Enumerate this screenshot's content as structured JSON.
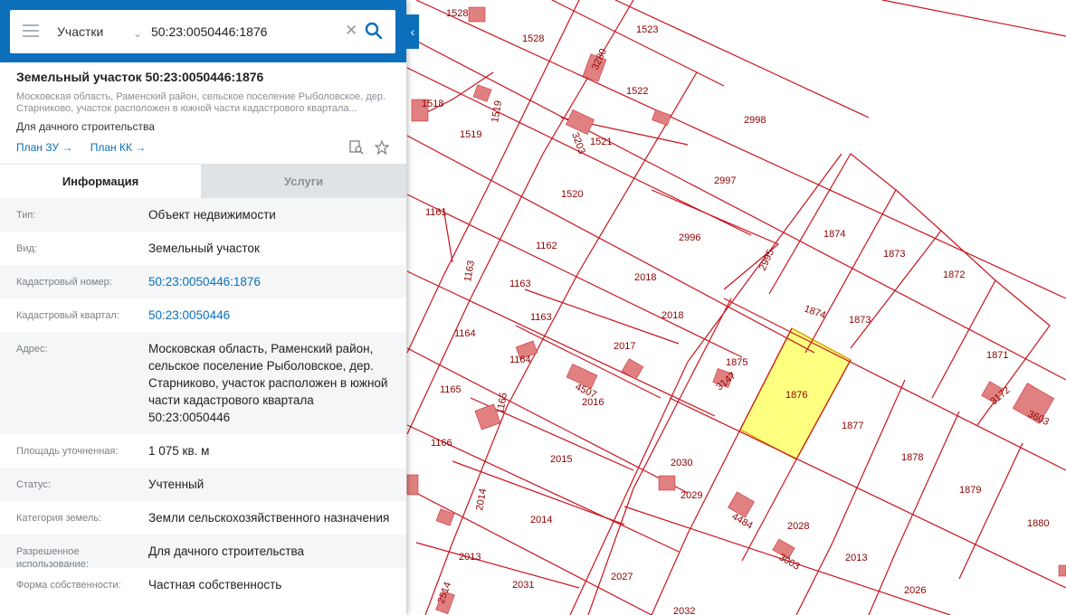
{
  "search": {
    "layer": "Участки",
    "query": "50:23:0050446:1876"
  },
  "parcel": {
    "title": "Земельный участок 50:23:0050446:1876",
    "address_short": "Московская область, Раменский район, сельское поселение Рыболовское, дер. Старниково, участок расположен в южной части кадастрового квартала...",
    "use": "Для дачного строительства",
    "links": [
      "План ЗУ →",
      "План КК →"
    ]
  },
  "tabs": [
    "Информация",
    "Услуги"
  ],
  "info": [
    {
      "key": "Тип:",
      "value": "Объект недвижимости",
      "link": false
    },
    {
      "key": "Вид:",
      "value": "Земельный участок",
      "link": false
    },
    {
      "key": "Кадастровый номер:",
      "value": "50:23:0050446:1876",
      "link": true
    },
    {
      "key": "Кадастровый квартал:",
      "value": "50:23:0050446",
      "link": true
    },
    {
      "key": "Адрес:",
      "value": "Московская область, Раменский район, сельское поселение Рыболовское, дер. Старниково, участок расположен в южной части кадастрового квартала 50:23:0050446",
      "link": false
    },
    {
      "key": "Площадь уточненная:",
      "value": "1 075 кв. м",
      "link": false
    },
    {
      "key": "Статус:",
      "value": "Учтенный",
      "link": false
    },
    {
      "key": "Категория земель:",
      "value": "Земли сельскохозяйственного назначения",
      "link": false
    },
    {
      "key": "Разрешенное использование:",
      "value": "Для дачного строительства",
      "link": false
    },
    {
      "key": "Форма собственности:",
      "value": "Частная собственность",
      "link": false
    }
  ],
  "map": {
    "parcel_labels": [
      "1528",
      "1528",
      "1523",
      "3280",
      "1522",
      "1518",
      "1519",
      "1519",
      "3203",
      "1521",
      "2998",
      "1520",
      "2997",
      "1161",
      "1162",
      "2996",
      "1163",
      "1163",
      "2018",
      "2995",
      "1874",
      "1874",
      "1873",
      "1872",
      "1163",
      "2018",
      "1873",
      "1164",
      "2017",
      "1875",
      "1164",
      "4507",
      "3147",
      "1876",
      "1871",
      "1165",
      "2016",
      "1165",
      "1877",
      "3172",
      "3603",
      "1166",
      "2015",
      "2030",
      "1878",
      "1879",
      "2029",
      "2014",
      "4484",
      "2014",
      "2028",
      "1880",
      "3003",
      "2013",
      "2031",
      "2027",
      "2013",
      "2026",
      "2032",
      "2514"
    ],
    "selected_parcel": "1876",
    "colors": {
      "boundary": "#c8141e",
      "building": "#e08080",
      "selected_fill": "#ffff80",
      "label": "#8c0000",
      "panel_accent": "#0b6fbb"
    }
  },
  "icons": [
    "menu-icon",
    "chevron-down-icon",
    "clear-icon",
    "search-icon",
    "chevron-left-icon",
    "plan-search-icon",
    "star-icon"
  ]
}
